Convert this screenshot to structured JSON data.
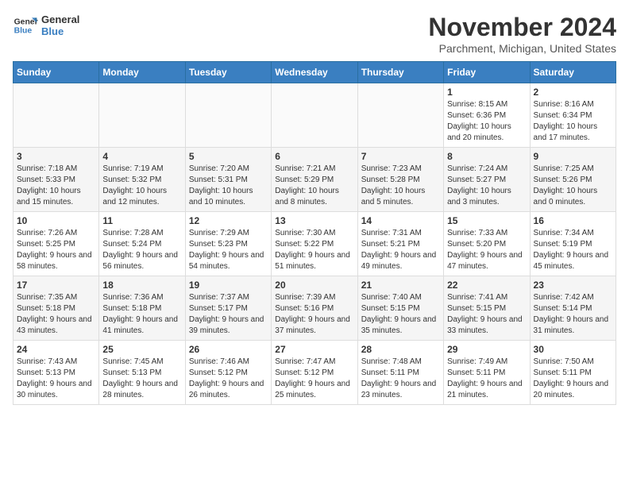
{
  "header": {
    "logo_line1": "General",
    "logo_line2": "Blue",
    "month_year": "November 2024",
    "location": "Parchment, Michigan, United States"
  },
  "weekdays": [
    "Sunday",
    "Monday",
    "Tuesday",
    "Wednesday",
    "Thursday",
    "Friday",
    "Saturday"
  ],
  "weeks": [
    [
      {
        "day": "",
        "info": ""
      },
      {
        "day": "",
        "info": ""
      },
      {
        "day": "",
        "info": ""
      },
      {
        "day": "",
        "info": ""
      },
      {
        "day": "",
        "info": ""
      },
      {
        "day": "1",
        "info": "Sunrise: 8:15 AM\nSunset: 6:36 PM\nDaylight: 10 hours and 20 minutes."
      },
      {
        "day": "2",
        "info": "Sunrise: 8:16 AM\nSunset: 6:34 PM\nDaylight: 10 hours and 17 minutes."
      }
    ],
    [
      {
        "day": "3",
        "info": "Sunrise: 7:18 AM\nSunset: 5:33 PM\nDaylight: 10 hours and 15 minutes."
      },
      {
        "day": "4",
        "info": "Sunrise: 7:19 AM\nSunset: 5:32 PM\nDaylight: 10 hours and 12 minutes."
      },
      {
        "day": "5",
        "info": "Sunrise: 7:20 AM\nSunset: 5:31 PM\nDaylight: 10 hours and 10 minutes."
      },
      {
        "day": "6",
        "info": "Sunrise: 7:21 AM\nSunset: 5:29 PM\nDaylight: 10 hours and 8 minutes."
      },
      {
        "day": "7",
        "info": "Sunrise: 7:23 AM\nSunset: 5:28 PM\nDaylight: 10 hours and 5 minutes."
      },
      {
        "day": "8",
        "info": "Sunrise: 7:24 AM\nSunset: 5:27 PM\nDaylight: 10 hours and 3 minutes."
      },
      {
        "day": "9",
        "info": "Sunrise: 7:25 AM\nSunset: 5:26 PM\nDaylight: 10 hours and 0 minutes."
      }
    ],
    [
      {
        "day": "10",
        "info": "Sunrise: 7:26 AM\nSunset: 5:25 PM\nDaylight: 9 hours and 58 minutes."
      },
      {
        "day": "11",
        "info": "Sunrise: 7:28 AM\nSunset: 5:24 PM\nDaylight: 9 hours and 56 minutes."
      },
      {
        "day": "12",
        "info": "Sunrise: 7:29 AM\nSunset: 5:23 PM\nDaylight: 9 hours and 54 minutes."
      },
      {
        "day": "13",
        "info": "Sunrise: 7:30 AM\nSunset: 5:22 PM\nDaylight: 9 hours and 51 minutes."
      },
      {
        "day": "14",
        "info": "Sunrise: 7:31 AM\nSunset: 5:21 PM\nDaylight: 9 hours and 49 minutes."
      },
      {
        "day": "15",
        "info": "Sunrise: 7:33 AM\nSunset: 5:20 PM\nDaylight: 9 hours and 47 minutes."
      },
      {
        "day": "16",
        "info": "Sunrise: 7:34 AM\nSunset: 5:19 PM\nDaylight: 9 hours and 45 minutes."
      }
    ],
    [
      {
        "day": "17",
        "info": "Sunrise: 7:35 AM\nSunset: 5:18 PM\nDaylight: 9 hours and 43 minutes."
      },
      {
        "day": "18",
        "info": "Sunrise: 7:36 AM\nSunset: 5:18 PM\nDaylight: 9 hours and 41 minutes."
      },
      {
        "day": "19",
        "info": "Sunrise: 7:37 AM\nSunset: 5:17 PM\nDaylight: 9 hours and 39 minutes."
      },
      {
        "day": "20",
        "info": "Sunrise: 7:39 AM\nSunset: 5:16 PM\nDaylight: 9 hours and 37 minutes."
      },
      {
        "day": "21",
        "info": "Sunrise: 7:40 AM\nSunset: 5:15 PM\nDaylight: 9 hours and 35 minutes."
      },
      {
        "day": "22",
        "info": "Sunrise: 7:41 AM\nSunset: 5:15 PM\nDaylight: 9 hours and 33 minutes."
      },
      {
        "day": "23",
        "info": "Sunrise: 7:42 AM\nSunset: 5:14 PM\nDaylight: 9 hours and 31 minutes."
      }
    ],
    [
      {
        "day": "24",
        "info": "Sunrise: 7:43 AM\nSunset: 5:13 PM\nDaylight: 9 hours and 30 minutes."
      },
      {
        "day": "25",
        "info": "Sunrise: 7:45 AM\nSunset: 5:13 PM\nDaylight: 9 hours and 28 minutes."
      },
      {
        "day": "26",
        "info": "Sunrise: 7:46 AM\nSunset: 5:12 PM\nDaylight: 9 hours and 26 minutes."
      },
      {
        "day": "27",
        "info": "Sunrise: 7:47 AM\nSunset: 5:12 PM\nDaylight: 9 hours and 25 minutes."
      },
      {
        "day": "28",
        "info": "Sunrise: 7:48 AM\nSunset: 5:11 PM\nDaylight: 9 hours and 23 minutes."
      },
      {
        "day": "29",
        "info": "Sunrise: 7:49 AM\nSunset: 5:11 PM\nDaylight: 9 hours and 21 minutes."
      },
      {
        "day": "30",
        "info": "Sunrise: 7:50 AM\nSunset: 5:11 PM\nDaylight: 9 hours and 20 minutes."
      }
    ]
  ]
}
